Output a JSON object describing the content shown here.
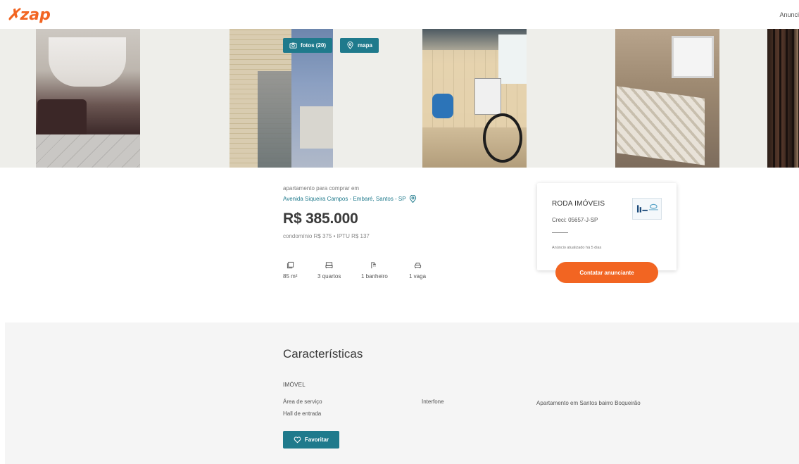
{
  "header": {
    "logo_text": "zap",
    "anunciar_label": "Anunci"
  },
  "gallery": {
    "fotos_label": "fotos (20)",
    "mapa_label": "mapa"
  },
  "listing": {
    "kind": "apartamento para comprar em",
    "address": "Avenida Siqueira Campos - Embaré, Santos - SP",
    "price": "R$ 385.000",
    "fees": "condomínio R$ 375  •  IPTU R$ 137",
    "amenities": [
      {
        "icon": "area-icon",
        "label": "85 m²"
      },
      {
        "icon": "bed-icon",
        "label": "3 quartos"
      },
      {
        "icon": "shower-icon",
        "label": "1 banheiro"
      },
      {
        "icon": "car-icon",
        "label": "1 vaga"
      }
    ]
  },
  "advertiser": {
    "name": "RODA IMÓVEIS",
    "creci": "Creci: 05657-J-SP",
    "updated": "Anúncio atualizado há 5 dias",
    "contact_label": "Contatar anunciante"
  },
  "features": {
    "title": "Características",
    "category": "IMÓVEL",
    "items": [
      "Área de serviço",
      "Hall de entrada",
      "Interfone"
    ],
    "description": "Apartamento em Santos bairro Boqueirão",
    "favorite_label": "Favoritar"
  },
  "colors": {
    "brand_orange": "#f26522",
    "teal": "#1f7a8c"
  }
}
